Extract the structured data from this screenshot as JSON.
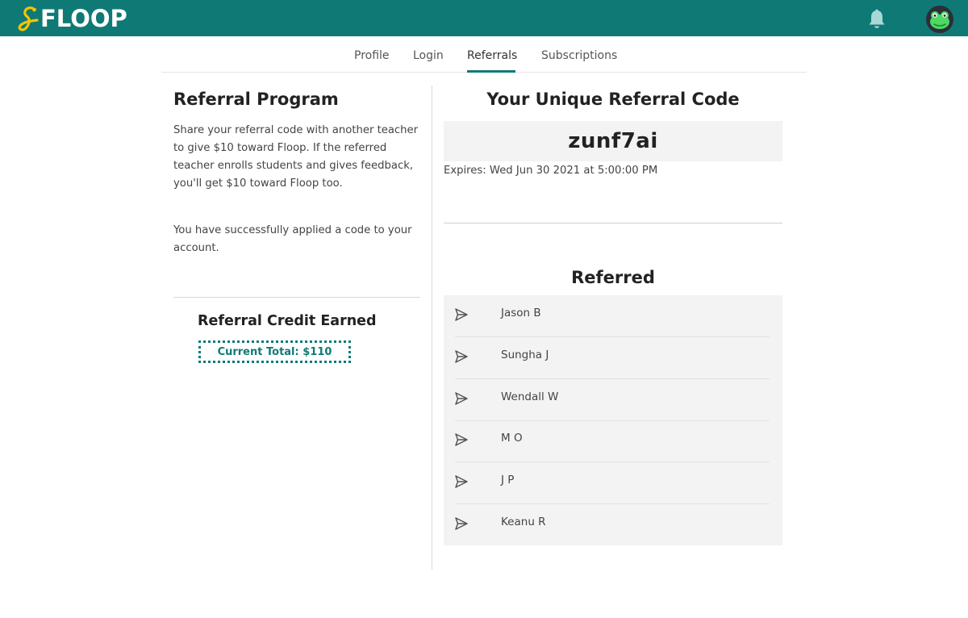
{
  "header": {
    "logo_text": "FLOOP",
    "colors": {
      "brand": "#0f7a75",
      "accent": "#f5c400",
      "bell": "#a8d8d5"
    },
    "icons": [
      "floop-logo-icon",
      "bell-icon",
      "frog-avatar-icon"
    ]
  },
  "tabs": [
    {
      "label": "Profile"
    },
    {
      "label": "Login"
    },
    {
      "label": "Referrals",
      "active": true
    },
    {
      "label": "Subscriptions"
    }
  ],
  "program": {
    "title": "Referral Program",
    "description": "Share your referral code with another teacher to give $10 toward Floop. If the referred teacher enrolls students and gives feedback, you'll get $10 toward Floop too.",
    "applied_message": "You have successfully applied a code to your account."
  },
  "credit": {
    "title": "Referral Credit Earned",
    "total": "Current Total: $110"
  },
  "code": {
    "title": "Your Unique Referral Code",
    "value": "zunf7ai",
    "expires": "Expires: Wed Jun 30 2021 at 5:00:00 PM"
  },
  "referred": {
    "title": "Referred",
    "icon": "send-icon",
    "items": [
      {
        "name": "Jason B"
      },
      {
        "name": "Sungha J"
      },
      {
        "name": "Wendall W"
      },
      {
        "name": "M O"
      },
      {
        "name": "J P"
      },
      {
        "name": "Keanu R"
      }
    ]
  }
}
